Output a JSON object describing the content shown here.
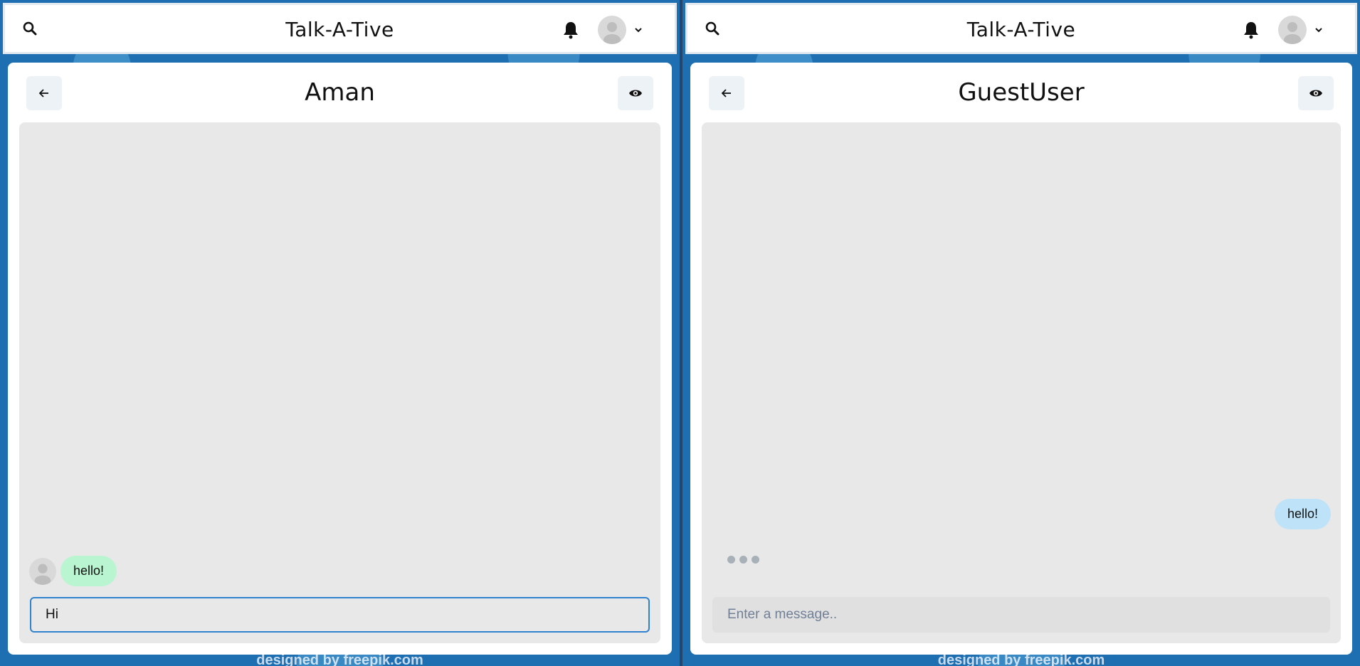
{
  "left": {
    "app_title": "Talk-A-Tive",
    "chat_title": "Aman",
    "messages": [
      {
        "text": "hello!",
        "sender": "other"
      }
    ],
    "input": {
      "value": "Hi",
      "placeholder": "Enter a message.."
    },
    "footer_credit": "designed by freepik.com"
  },
  "right": {
    "app_title": "Talk-A-Tive",
    "chat_title": "GuestUser",
    "messages": [
      {
        "text": "hello!",
        "sender": "self"
      }
    ],
    "typing_indicator": true,
    "input": {
      "value": "",
      "placeholder": "Enter a message.."
    },
    "footer_credit": "designed by freepik.com"
  },
  "icons": {
    "search": "search-icon",
    "bell": "bell-icon",
    "avatar": "user-avatar-icon",
    "chevron": "chevron-down-icon",
    "back": "arrow-left-icon",
    "view": "eye-icon"
  },
  "colors": {
    "background": "#1e6eb2",
    "incoming_bubble": "#b9f5d0",
    "outgoing_bubble": "#bee3f8",
    "focus_border": "#3182ce",
    "chat_area": "#e8e8e8"
  }
}
